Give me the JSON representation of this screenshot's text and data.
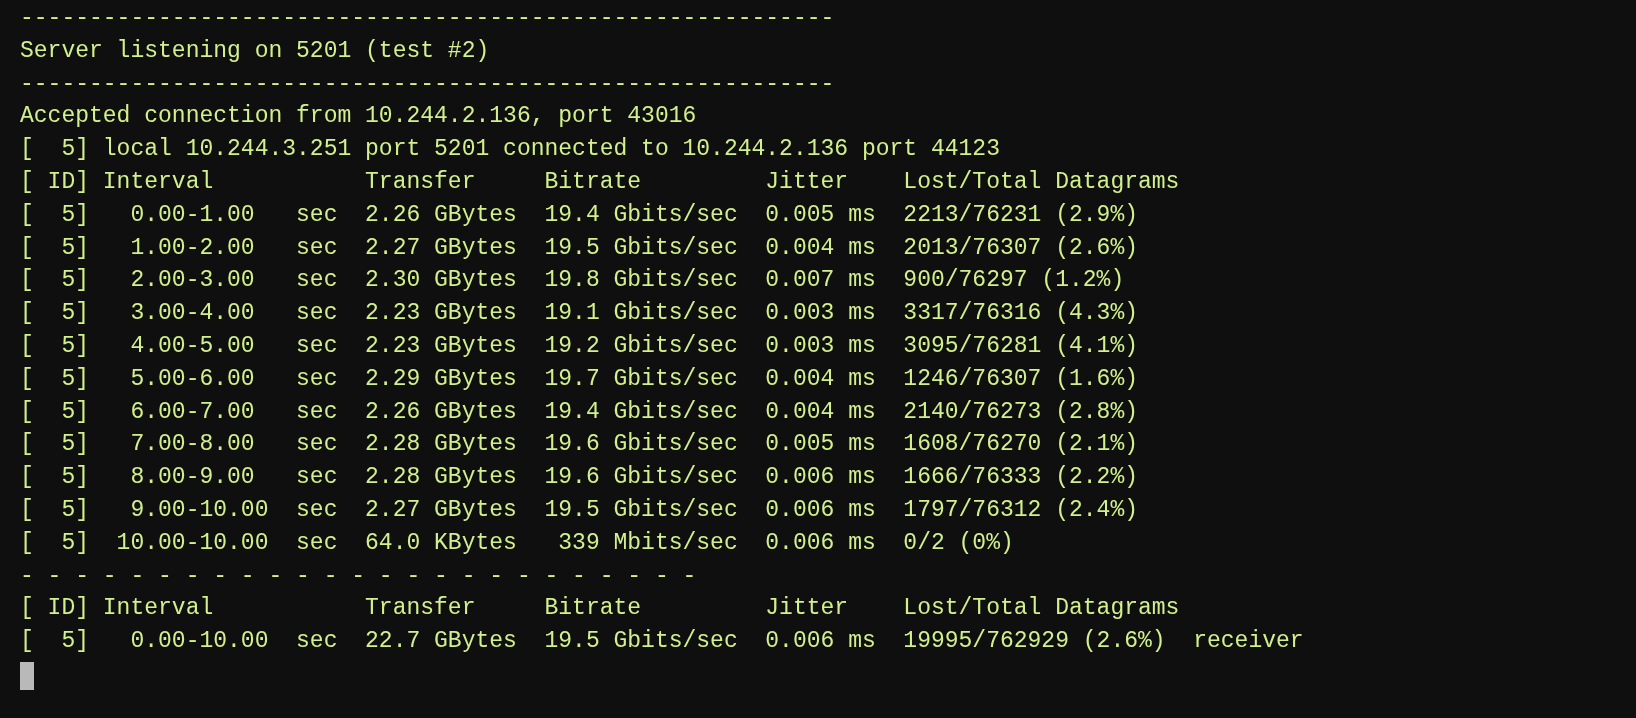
{
  "terminal": {
    "lines": [
      "-----------------------------------------------------------",
      "Server listening on 5201 (test #2)",
      "-----------------------------------------------------------",
      "Accepted connection from 10.244.2.136, port 43016",
      "[  5] local 10.244.3.251 port 5201 connected to 10.244.2.136 port 44123",
      "[ ID] Interval           Transfer     Bitrate         Jitter    Lost/Total Datagrams",
      "[  5]   0.00-1.00   sec  2.26 GBytes  19.4 Gbits/sec  0.005 ms  2213/76231 (2.9%)",
      "[  5]   1.00-2.00   sec  2.27 GBytes  19.5 Gbits/sec  0.004 ms  2013/76307 (2.6%)",
      "[  5]   2.00-3.00   sec  2.30 GBytes  19.8 Gbits/sec  0.007 ms  900/76297 (1.2%)",
      "[  5]   3.00-4.00   sec  2.23 GBytes  19.1 Gbits/sec  0.003 ms  3317/76316 (4.3%)",
      "[  5]   4.00-5.00   sec  2.23 GBytes  19.2 Gbits/sec  0.003 ms  3095/76281 (4.1%)",
      "[  5]   5.00-6.00   sec  2.29 GBytes  19.7 Gbits/sec  0.004 ms  1246/76307 (1.6%)",
      "[  5]   6.00-7.00   sec  2.26 GBytes  19.4 Gbits/sec  0.004 ms  2140/76273 (2.8%)",
      "[  5]   7.00-8.00   sec  2.28 GBytes  19.6 Gbits/sec  0.005 ms  1608/76270 (2.1%)",
      "[  5]   8.00-9.00   sec  2.28 GBytes  19.6 Gbits/sec  0.006 ms  1666/76333 (2.2%)",
      "[  5]   9.00-10.00  sec  2.27 GBytes  19.5 Gbits/sec  0.006 ms  1797/76312 (2.4%)",
      "[  5]  10.00-10.00  sec  64.0 KBytes   339 Mbits/sec  0.006 ms  0/2 (0%)",
      "- - - - - - - - - - - - - - - - - - - - - - - - -",
      "[ ID] Interval           Transfer     Bitrate         Jitter    Lost/Total Datagrams",
      "[  5]   0.00-10.00  sec  22.7 GBytes  19.5 Gbits/sec  0.006 ms  19995/762929 (2.6%)  receiver"
    ]
  }
}
